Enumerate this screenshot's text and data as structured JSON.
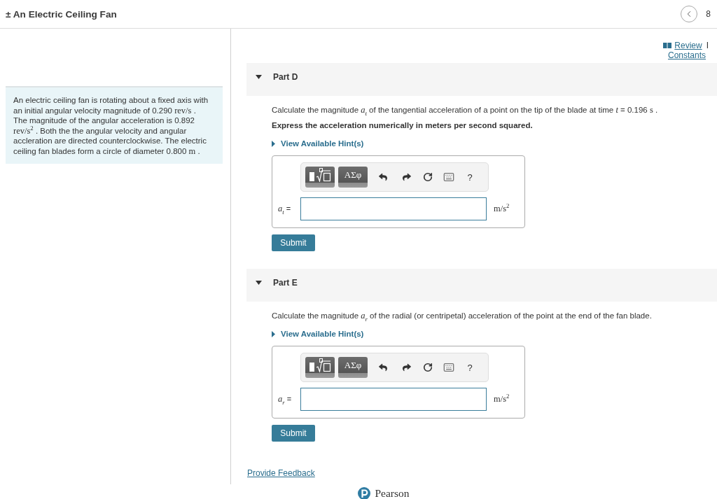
{
  "header": {
    "title": "± An Electric Ceiling Fan",
    "counter": "8"
  },
  "problem": {
    "segments": [
      {
        "kind": "text",
        "text": "An electric ceiling fan is rotating about a fixed axis with an initial angular velocity magnitude of 0.290 "
      },
      {
        "kind": "unit",
        "text": "rev/s"
      },
      {
        "kind": "text",
        "text": " . The magnitude of the angular acceleration is 0.892 "
      },
      {
        "kind": "unit",
        "text": "rev/s$^{2}$"
      },
      {
        "kind": "text",
        "text": " . Both the the angular velocity and angular accleration are directed counterclockwise. The electric ceiling fan blades form a circle of diameter 0.800 "
      },
      {
        "kind": "unit",
        "text": "m"
      },
      {
        "kind": "text",
        "text": " ."
      }
    ]
  },
  "resources": {
    "review": "Review",
    "separator": "I",
    "constants": "Constants"
  },
  "parts": [
    {
      "title": "Part D",
      "expanded": true,
      "question": [
        {
          "kind": "text",
          "text": "Calculate the magnitude "
        },
        {
          "kind": "variable",
          "text": "a$_{t}$"
        },
        {
          "kind": "text",
          "text": " of the tangential acceleration of a point on the tip of the blade at time "
        },
        {
          "kind": "variable",
          "text": "t"
        },
        {
          "kind": "text",
          "text": " = 0.196 "
        },
        {
          "kind": "unit",
          "text": "s"
        },
        {
          "kind": "text",
          "text": " ."
        }
      ],
      "instruction": "Express the acceleration numerically in meters per second squared.",
      "hint": "View Available Hint(s)",
      "toolbar": {
        "symbols": "ΑΣφ",
        "help": "?"
      },
      "answer": {
        "variable": "a$_{t}$",
        "equals": "=",
        "unit": "m/s$^{2}$"
      },
      "submit": "Submit"
    },
    {
      "title": "Part E",
      "expanded": true,
      "question": [
        {
          "kind": "text",
          "text": "Calculate the magnitude "
        },
        {
          "kind": "variable",
          "text": "a$_{r}$"
        },
        {
          "kind": "text",
          "text": " of the radial (or centripetal) acceleration of the point at the end of the fan blade."
        }
      ],
      "hint": "View Available Hint(s)",
      "toolbar": {
        "symbols": "ΑΣφ",
        "help": "?"
      },
      "answer": {
        "variable": "a$_{r}$",
        "equals": "=",
        "unit": "m/s$^{2}$"
      },
      "submit": "Submit"
    }
  ],
  "feedback": "Provide Feedback",
  "footer": {
    "brand": "Pearson"
  }
}
